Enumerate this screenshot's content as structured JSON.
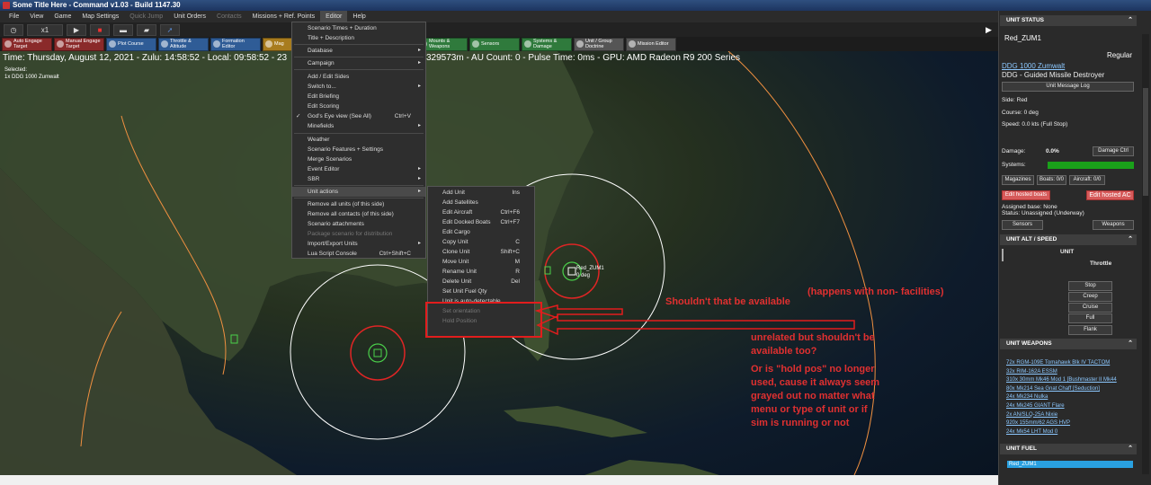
{
  "window": {
    "title": "Some Title Here - Command v1.03 - Build 1147.30"
  },
  "menubar": {
    "items": [
      {
        "label": "File"
      },
      {
        "label": "View"
      },
      {
        "label": "Game"
      },
      {
        "label": "Map Settings"
      },
      {
        "label": "Quick Jump",
        "disabled": true
      },
      {
        "label": "Unit Orders"
      },
      {
        "label": "Contacts",
        "disabled": true
      },
      {
        "label": "Missions + Ref. Points"
      },
      {
        "label": "Editor"
      },
      {
        "label": "Help"
      }
    ]
  },
  "toolbar1": {
    "speed_label": "x1"
  },
  "toolbar2": {
    "buttons": [
      {
        "label": "Auto Engage Target",
        "color": "red"
      },
      {
        "label": "Manual Engage Target",
        "color": "red"
      },
      {
        "label": "Plot Course",
        "color": "blue"
      },
      {
        "label": "Throttle & Altitude",
        "color": "blue"
      },
      {
        "label": "Formation Editor",
        "color": "blue"
      },
      {
        "label": "Mag",
        "color": "orange"
      },
      {
        "label": "Mounts & Weapons",
        "color": "green"
      },
      {
        "label": "Sensors",
        "color": "green"
      },
      {
        "label": "Systems & Damage",
        "color": "green"
      },
      {
        "label": "Unit / Group Doctrine",
        "color": "gray"
      },
      {
        "label": "Mission Editor",
        "color": "gray"
      }
    ]
  },
  "status": {
    "time_left": "Time: Thursday, August 12, 2021 - Zulu: 14:58:52 - Local: 09:58:52 - 23",
    "time_right": "329573m - AU Count: 0 - Pulse Time: 0ms - GPU: AMD Radeon R9 200 Series"
  },
  "selected": {
    "header": "Selected:",
    "unit": "1x DDG 1000 Zumwalt"
  },
  "editor_menu": {
    "items": [
      {
        "label": "Scenario Times + Duration"
      },
      {
        "label": "Title + Description"
      },
      {
        "label": "Database",
        "arrow": true
      },
      {
        "label": "Campaign",
        "arrow": true
      },
      {
        "label": "Add / Edit Sides"
      },
      {
        "label": "Switch to...",
        "arrow": true
      },
      {
        "label": "Edit Briefing"
      },
      {
        "label": "Edit Scoring"
      },
      {
        "label": "God's Eye view (See All)",
        "shortcut": "Ctrl+V",
        "check": "✓"
      },
      {
        "label": "Minefields",
        "arrow": true
      },
      {
        "label": "Weather"
      },
      {
        "label": "Scenario Features + Settings"
      },
      {
        "label": "Merge Scenarios"
      },
      {
        "label": "Event Editor",
        "arrow": true
      },
      {
        "label": "SBR",
        "arrow": true
      },
      {
        "label": "Unit actions",
        "arrow": true,
        "highlight": true
      },
      {
        "label": "Remove all units (of this side)"
      },
      {
        "label": "Remove all contacts (of this side)"
      },
      {
        "label": "Scenario attachments"
      },
      {
        "label": "Package scenario for distribution",
        "disabled": true
      },
      {
        "label": "Import/Export Units",
        "arrow": true
      },
      {
        "label": "Lua Script Console",
        "shortcut": "Ctrl+Shift+C"
      }
    ]
  },
  "unit_actions_menu": {
    "items": [
      {
        "label": "Add Unit",
        "shortcut": "Ins"
      },
      {
        "label": "Add Satellites"
      },
      {
        "label": "Edit Aircraft",
        "shortcut": "Ctrl+F6"
      },
      {
        "label": "Edit Docked Boats",
        "shortcut": "Ctrl+F7"
      },
      {
        "label": "Edit Cargo"
      },
      {
        "label": "Copy Unit",
        "shortcut": "C"
      },
      {
        "label": "Clone Unit",
        "shortcut": "Shift+C"
      },
      {
        "label": "Move Unit",
        "shortcut": "M"
      },
      {
        "label": "Rename Unit",
        "shortcut": "R"
      },
      {
        "label": "Delete Unit",
        "shortcut": "Del"
      },
      {
        "label": "Set Unit Fuel Qty"
      },
      {
        "label": "Unit is auto-detectable"
      },
      {
        "label": "Set orientation",
        "disabled": true
      },
      {
        "label": "Hold Position",
        "disabled": true
      }
    ]
  },
  "map_labels": {
    "unit": "Red_ZUM1",
    "heading": "0 deg"
  },
  "annotations": {
    "note1": "Shouldn't that be available",
    "note2": "(happens with non- facilities)",
    "note3": "unrelated but shouldn't be available too?",
    "note4": "Or is \"hold pos\" no longer used, cause it always seem grayed out no matter what menu or type of unit or if sim is running or not"
  },
  "unit_status": {
    "header": "UNIT STATUS",
    "unit_name": "Red_ZUM1",
    "proficiency": "Regular",
    "class_link": "DDG 1000 Zumwalt",
    "class_desc": "DDG - Guided Missile Destroyer",
    "msg_log_button": "Unit Message Log",
    "side": "Side: Red",
    "course": "Course: 0 deg",
    "speed": "Speed: 0.0 kts (Full Stop)",
    "damage_label": "Damage:",
    "damage_value": "0.0%",
    "damage_ctrl_button": "Damage Ctrl",
    "systems_label": "Systems:",
    "systems_fraction": 1.0,
    "magazines_button": "Magazines",
    "boats_button": "Boats: 0/0",
    "aircraft_button": "Aircraft: 0/0",
    "edit_boats_button": "Edit hosted boats",
    "edit_ac_button": "Edit hosted AC",
    "assigned_base": "Assigned base: None",
    "assign_status": "Status: Unassigned (Underway)",
    "sensors_button": "Sensors",
    "weapons_button": "Weapons"
  },
  "alt_speed": {
    "header": "UNIT ALT / SPEED",
    "unit_label": "UNIT",
    "throttle_label": "Throttle",
    "buttons": [
      "Stop",
      "Creep",
      "Cruise",
      "Full",
      "Flank"
    ]
  },
  "unit_weapons": {
    "header": "UNIT WEAPONS",
    "items": [
      "72x RGM-109E Tomahawk Blk IV TACTOM",
      "32x RIM-162A ESSM",
      "310x 30mm Mk46 Mod 1 [Bushmaster II Mk44",
      "80x Mk214 Sea Gnat Chaff [Seduction]",
      "24x Mk234 Nulka",
      "24x Mk245 GIANT Flare",
      "2x AN/SLQ-25A Nixie",
      "920x 155mm/62 AGS HVP",
      "24x Mk54 LHT Mod 0"
    ]
  },
  "unit_fuel": {
    "header": "UNIT FUEL",
    "bar_label": "Red_ZUM1"
  },
  "colors": {
    "accent_red": "#e03030",
    "panel_bg": "#2a2a2a",
    "link": "#8cc8ff"
  }
}
